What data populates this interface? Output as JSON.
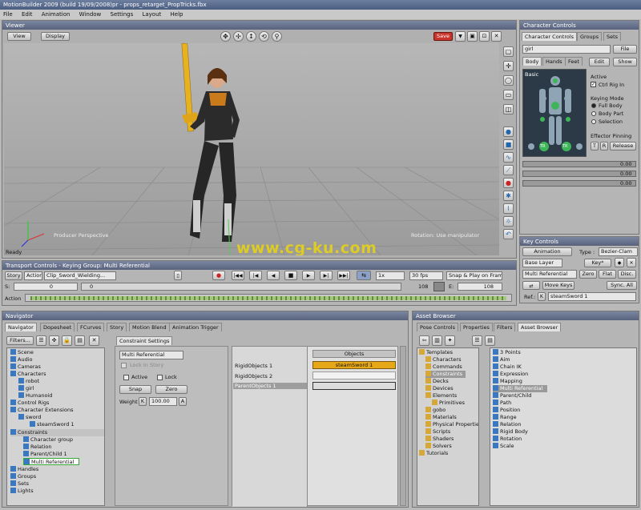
{
  "app": {
    "title": "MotionBuilder 2009  (build 19/09/2008)pr  - props_retarget_PropTricks.fbx"
  },
  "menu": [
    "File",
    "Edit",
    "Animation",
    "Window",
    "Settings",
    "Layout",
    "Help"
  ],
  "viewer": {
    "title": "Viewer",
    "view_label": "View",
    "display_label": "Display",
    "save_label": "Save",
    "camera_label": "Producer Perspective",
    "status_ready": "Ready",
    "rotation_label": "Rotation: Use manipulator",
    "watermark": "www.cg-ku.com"
  },
  "character_controls": {
    "title": "Character Controls",
    "tabs": [
      "Character Controls",
      "Groups",
      "Sets"
    ],
    "character": "girl",
    "file_label": "File",
    "body_tabs": [
      "Body",
      "Hands",
      "Feet"
    ],
    "edit_label": "Edit",
    "show_label": "Show",
    "basic_label": "Basic",
    "active_label": "Active",
    "ctrl_rig_in": "Ctrl Rig In",
    "keying_mode_label": "Keying Mode",
    "keying_modes": [
      "Full Body",
      "Body Part",
      "Selection"
    ],
    "effector_pinning": "Effector Pinning",
    "t_label": "T",
    "r_label": "R",
    "release_label": "Release",
    "tr_label": "TR",
    "slider_values": [
      "0.00",
      "0.00",
      "0.00"
    ]
  },
  "key_controls": {
    "title": "Key Controls",
    "animation_label": "Animation",
    "type_label": "Type :",
    "type_value": "Bezier-Clam",
    "base_layer": "Base Layer",
    "key_label": "Key*",
    "layer_value": "Multi Referential",
    "zero_label": "Zero",
    "flat_label": "Flat",
    "disc_label": "Disc.",
    "move_keys": "Move Keys",
    "sync_all": "Sync. All",
    "ref_label": "Ref.:",
    "ref_k": "K",
    "ref_value": "steamSword 1"
  },
  "transport": {
    "title": "Transport Controls  -  Keying Group: Multi Referential",
    "story_label": "Story",
    "action_label": "Action",
    "clip_label": "Clip_Sword_Wielding...",
    "speed": "1x",
    "fps": "30 fps",
    "snap": "Snap & Play on Frames",
    "s_label": "S:",
    "s_value": "0",
    "e_label": "E:",
    "e_value": "108",
    "start_value": "0",
    "current_value": "108",
    "action_row": "Action"
  },
  "navigator": {
    "title": "Navigator",
    "tabs": [
      "Navigator",
      "Dopesheet",
      "FCurves",
      "Story",
      "Motion Blend",
      "Animation Trigger"
    ],
    "filters_label": "Filters...",
    "tree": [
      "Scene",
      "Audio",
      "Cameras",
      "Characters",
      "robot",
      "girl",
      "Humanoid",
      "Control Rigs",
      "Character Extensions",
      "sword",
      "steamSword 1",
      "Constraints",
      "Character group",
      "Relation",
      "Parent/Child 1",
      "Multi Referential",
      "Handles",
      "Groups",
      "Sets",
      "Lights"
    ],
    "constraint_settings_tab": "Constraint Settings",
    "constraint_name": "Multi Referential",
    "lock_in_story": "Lock In Story",
    "active_label": "Active",
    "lock_label": "Lock",
    "snap_label": "Snap",
    "zero_label": "Zero",
    "weight_label": "Weight",
    "weight_k": "K",
    "weight_value": "100.00",
    "weight_a": "A",
    "rows": [
      "RigidObjects 1",
      "RigidObjects 2",
      "ParentObjects 1"
    ],
    "objects_header": "Objects",
    "object_value": "steamSword 1"
  },
  "asset_browser": {
    "title": "Asset Browser",
    "tabs": [
      "Pose Controls",
      "Properties",
      "Filters",
      "Asset Browser"
    ],
    "folders": [
      "Templates",
      "Characters",
      "Commands",
      "Constraints",
      "Decks",
      "Devices",
      "Elements",
      "Primitives",
      "gobo",
      "Materials",
      "Physical Properties",
      "Scripts",
      "Shaders",
      "Solvers",
      "Tutorials"
    ],
    "items": [
      "3 Points",
      "Aim",
      "Chain IK",
      "Expression",
      "Mapping",
      "Multi Referential",
      "Parent/Child",
      "Path",
      "Position",
      "Range",
      "Relation",
      "Rigid Body",
      "Rotation",
      "Scale"
    ]
  },
  "colors": {
    "accent": "#e8a817",
    "selection": "#8ca0c8",
    "header": "#5f6a86"
  }
}
